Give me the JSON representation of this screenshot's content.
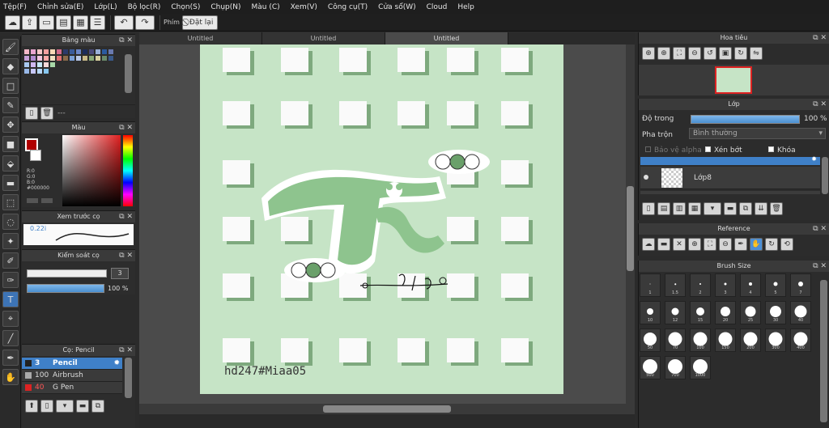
{
  "menu": [
    "Tệp(F)",
    "Chỉnh sửa(E)",
    "Lớp(L)",
    "Bộ lọc(R)",
    "Chọn(S)",
    "Chụp(N)",
    "Màu (C)",
    "Xem(V)",
    "Công cụ(T)",
    "Cửa sổ(W)",
    "Cloud",
    "Help"
  ],
  "toolbar": {
    "phim": "Phím",
    "reset": "Đặt lại"
  },
  "tabs": [
    "Untitled",
    "Untitled",
    "Untitled"
  ],
  "palette": {
    "title": "Bảng màu",
    "footer": "---"
  },
  "color": {
    "title": "Màu",
    "r": "R:0",
    "g": "G:0",
    "b": "B:0",
    "hex": "#000000",
    "fg": "#c00000"
  },
  "brushpreview": {
    "title": "Xem trước cọ",
    "size": "0.22i"
  },
  "brushcontrol": {
    "title": "Kiểm soát cọ",
    "size": "3",
    "opacity": "100 %"
  },
  "brushlist": {
    "title": "Cọ: Pencil",
    "items": [
      {
        "size": "3",
        "name": "Pencil"
      },
      {
        "size": "100",
        "name": "Airbrush"
      },
      {
        "size": "40",
        "name": "G Pen"
      }
    ]
  },
  "navigator": {
    "title": "Hoa tiêu"
  },
  "layer": {
    "title": "Lớp",
    "opacity_label": "Độ trong",
    "opacity_value": "100 %",
    "blend_label": "Pha trộn",
    "blend_value": "Bình thường",
    "protect_alpha": "Bảo vệ alpha",
    "clipping": "Xén bớt",
    "lock": "Khóa",
    "layer_name": "Lớp8"
  },
  "reference": {
    "title": "Reference"
  },
  "brushsize": {
    "title": "Brush Size",
    "sizes": [
      "1",
      "1.5",
      "2",
      "3",
      "4",
      "5",
      "7",
      "10",
      "12",
      "15",
      "20",
      "25",
      "30",
      "40",
      "50",
      "70",
      "100",
      "150",
      "200",
      "300",
      "400",
      "500",
      "700",
      "1000"
    ]
  },
  "canvas": {
    "watermark": "hd247#Miaa05"
  },
  "colors": {
    "accent": "#3f80c8",
    "art_bg": "#c6e4c6",
    "shadow": "#7ea97e",
    "title_green": "#8ec48e"
  }
}
